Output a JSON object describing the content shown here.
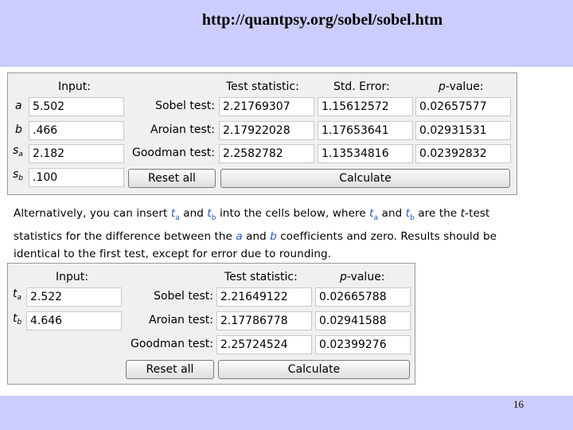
{
  "slide": {
    "url": "http://quantpsy.org/sobel/sobel.htm",
    "page_number": "16",
    "band_color": "#ccccff"
  },
  "calc1": {
    "headers": {
      "input": "Input:",
      "test_statistic": "Test statistic:",
      "std_error": "Std. Error:",
      "p_value_italic": "p",
      "p_value_rest": "-value:"
    },
    "inputs": {
      "a": {
        "symbol": "a",
        "value": "5.502"
      },
      "b": {
        "symbol": "b",
        "value": ".466"
      },
      "sa": {
        "symbol": "s",
        "sub": "a",
        "value": "2.182"
      },
      "sb": {
        "symbol": "s",
        "sub": "b",
        "value": ".100"
      }
    },
    "tests": {
      "sobel": {
        "label": "Sobel test:",
        "stat": "2.21769307",
        "se": "1.15612572",
        "p": "0.02657577"
      },
      "aroian": {
        "label": "Aroian test:",
        "stat": "2.17922028",
        "se": "1.17653641",
        "p": "0.02931531"
      },
      "goodman": {
        "label": "Goodman test:",
        "stat": "2.2582782",
        "se": "1.13534816",
        "p": "0.02392832"
      }
    },
    "reset_label": "Reset all",
    "calculate_label": "Calculate"
  },
  "paragraph": {
    "l1_a": "Alternatively, you can insert ",
    "l1_t1": "t",
    "l1_t1_sub": "a",
    "l1_and1": " and ",
    "l1_t2": "t",
    "l1_t2_sub": "b",
    "l1_b": " into the cells below, where ",
    "l1_t3": "t",
    "l1_t3_sub": "a",
    "l1_and2": " and ",
    "l1_t4": "t",
    "l1_t4_sub": "b",
    "l1_c": " are the ",
    "l1_t_italic": "t",
    "l1_d": "-test",
    "l2_a": "statistics for the difference between the ",
    "l2_a_var": "a",
    "l2_and": " and ",
    "l2_b_var": "b",
    "l2_b": " coefficients and zero. Results should be",
    "l3": "identical to the first test, except for error due to rounding."
  },
  "calc2": {
    "headers": {
      "input": "Input:",
      "test_statistic": "Test statistic:",
      "p_value_italic": "p",
      "p_value_rest": "-value:"
    },
    "inputs": {
      "ta": {
        "symbol": "t",
        "sub": "a",
        "value": "2.522"
      },
      "tb": {
        "symbol": "t",
        "sub": "b",
        "value": "4.646"
      }
    },
    "tests": {
      "sobel": {
        "label": "Sobel test:",
        "stat": "2.21649122",
        "p": "0.02665788"
      },
      "aroian": {
        "label": "Aroian test:",
        "stat": "2.17786778",
        "p": "0.02941588"
      },
      "goodman": {
        "label": "Goodman test:",
        "stat": "2.25724524",
        "p": "0.02399276"
      }
    },
    "reset_label": "Reset all",
    "calculate_label": "Calculate"
  }
}
